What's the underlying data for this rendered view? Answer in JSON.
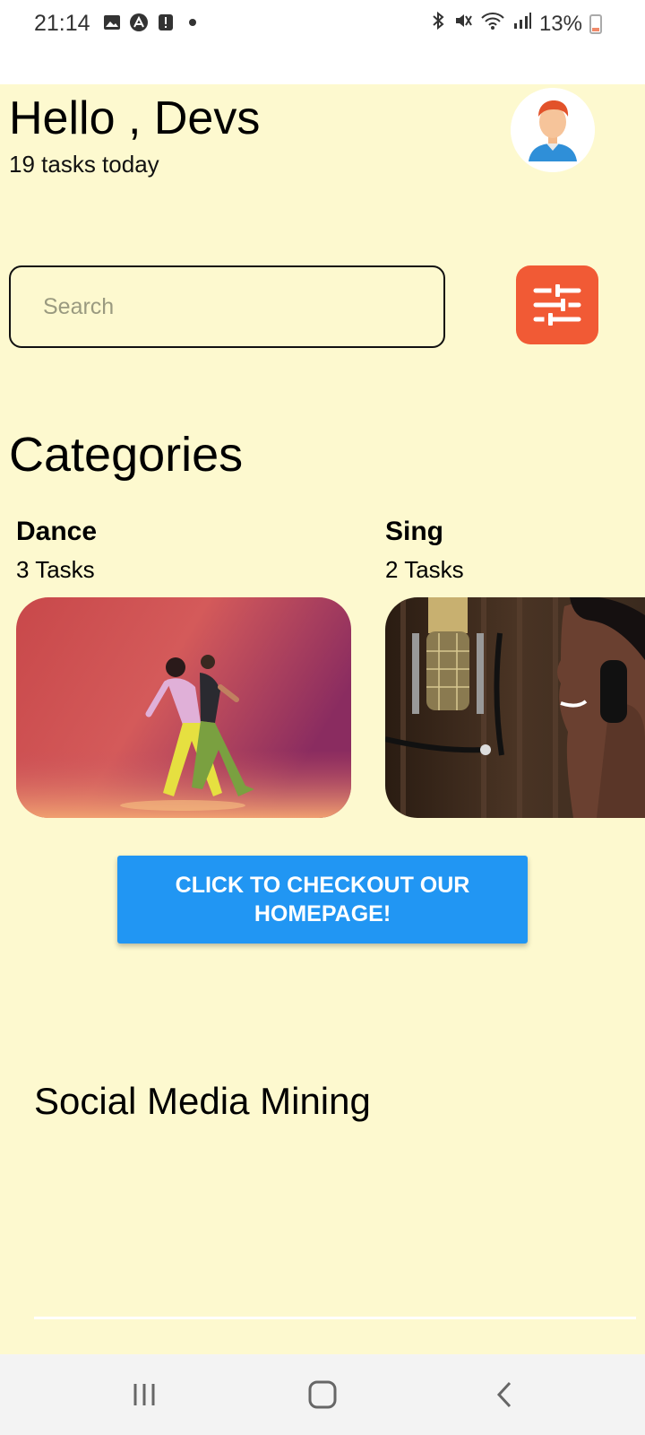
{
  "status_bar": {
    "time": "21:14",
    "battery": "13%",
    "icons": [
      "image-icon",
      "app-icon",
      "alert-icon",
      "dot-icon",
      "bluetooth-icon",
      "mute-icon",
      "wifi-icon",
      "signal-icon",
      "battery-icon"
    ]
  },
  "header": {
    "greeting": "Hello , Devs",
    "subtitle": "19 tasks today"
  },
  "search": {
    "placeholder": "Search"
  },
  "categories": {
    "title": "Categories",
    "items": [
      {
        "name": "Dance",
        "count": "3 Tasks"
      },
      {
        "name": "Sing",
        "count": "2 Tasks"
      }
    ]
  },
  "cta": {
    "label": "CLICK TO CHECKOUT OUR HOMEPAGE!"
  },
  "section": {
    "title": "Social Media Mining"
  },
  "colors": {
    "background": "#fdf9cf",
    "filter_button": "#f15a35",
    "cta_button": "#2196f3"
  },
  "nav_bar": {
    "icons": [
      "recents-icon",
      "home-icon",
      "back-icon"
    ]
  }
}
